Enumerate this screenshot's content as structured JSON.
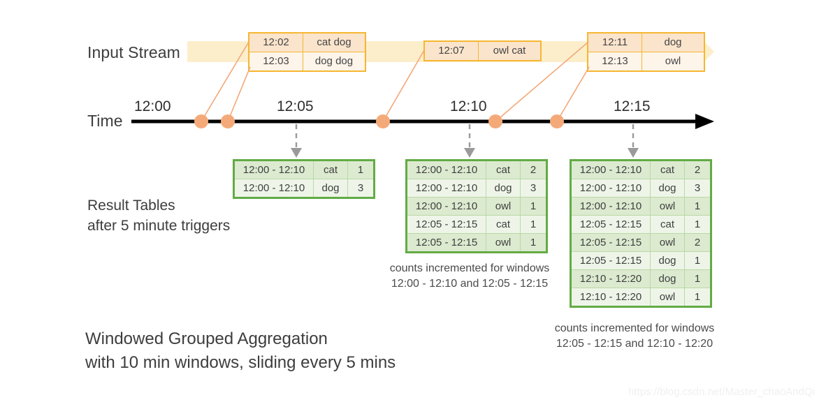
{
  "labels": {
    "input_stream": "Input Stream",
    "time": "Time",
    "result_tables_line1": "Result Tables",
    "result_tables_line2": "after 5 minute triggers",
    "title_line1": "Windowed Grouped Aggregation",
    "title_line2": "with 10 min windows, sliding every 5 mins"
  },
  "timeline": {
    "ticks": [
      "12:00",
      "12:05",
      "12:10",
      "12:15"
    ],
    "event_dots_minutes": [
      "12:02",
      "12:03",
      "12:07",
      "12:11",
      "12:13"
    ]
  },
  "input_events": [
    {
      "rows": [
        {
          "time": "12:02",
          "words": "cat dog"
        },
        {
          "time": "12:03",
          "words": "dog dog"
        }
      ]
    },
    {
      "rows": [
        {
          "time": "12:07",
          "words": "owl cat"
        }
      ]
    },
    {
      "rows": [
        {
          "time": "12:11",
          "words": "dog"
        },
        {
          "time": "12:13",
          "words": "owl"
        }
      ]
    }
  ],
  "result_tables": [
    {
      "trigger": "12:05",
      "rows": [
        {
          "window": "12:00 - 12:10",
          "key": "cat",
          "count": "1"
        },
        {
          "window": "12:00 - 12:10",
          "key": "dog",
          "count": "3"
        }
      ],
      "caption_line1": "",
      "caption_line2": ""
    },
    {
      "trigger": "12:10",
      "rows": [
        {
          "window": "12:00 - 12:10",
          "key": "cat",
          "count": "2"
        },
        {
          "window": "12:00 - 12:10",
          "key": "dog",
          "count": "3"
        },
        {
          "window": "12:00 - 12:10",
          "key": "owl",
          "count": "1"
        },
        {
          "window": "12:05 - 12:15",
          "key": "cat",
          "count": "1"
        },
        {
          "window": "12:05 - 12:15",
          "key": "owl",
          "count": "1"
        }
      ],
      "caption_line1": "counts incremented for windows",
      "caption_line2": "12:00 - 12:10 and 12:05 - 12:15"
    },
    {
      "trigger": "12:15",
      "rows": [
        {
          "window": "12:00 - 12:10",
          "key": "cat",
          "count": "2"
        },
        {
          "window": "12:00 - 12:10",
          "key": "dog",
          "count": "3"
        },
        {
          "window": "12:00 - 12:10",
          "key": "owl",
          "count": "1"
        },
        {
          "window": "12:05 - 12:15",
          "key": "cat",
          "count": "1"
        },
        {
          "window": "12:05 - 12:15",
          "key": "owl",
          "count": "2"
        },
        {
          "window": "12:05 - 12:15",
          "key": "dog",
          "count": "1"
        },
        {
          "window": "12:10 - 12:20",
          "key": "dog",
          "count": "1"
        },
        {
          "window": "12:10 - 12:20",
          "key": "owl",
          "count": "1"
        }
      ],
      "caption_line1": "counts incremented for windows",
      "caption_line2": "12:05 - 12:15 and 12:10 - 12:20"
    }
  ],
  "watermark": "https://blog.csdn.net/Master_chaoAndQi",
  "colors": {
    "stream_band": "#fdeecb",
    "event_border": "#f5b731",
    "event_fill_odd": "#fbe4cc",
    "event_fill_even": "#fdf4ea",
    "result_border": "#63ab45",
    "result_fill_odd": "#dcead0",
    "result_fill_even": "#eef5e8",
    "dot": "#f4aa78",
    "timeline": "#000000",
    "pointer": "#9a9a9a"
  }
}
